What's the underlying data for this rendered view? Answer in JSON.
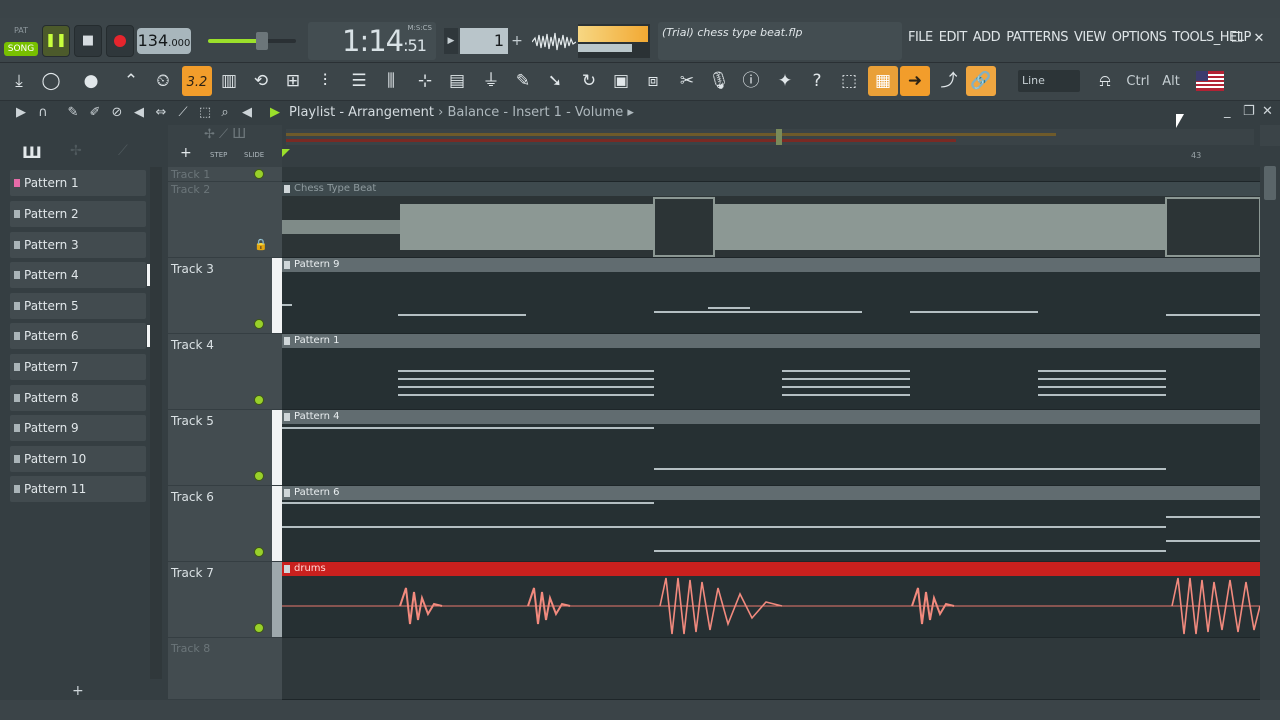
{
  "transport": {
    "pat_label": "PAT",
    "song_label": "SONG",
    "tempo_main": "134",
    "tempo_frac": ".000",
    "time_main": "1:14",
    "time_cs": ":51",
    "time_unit": "M:S:CS",
    "pattern_number": "1",
    "hint_text": "(Trial) chess type beat.flp"
  },
  "menu": {
    "items": [
      "FILE",
      "EDIT",
      "ADD",
      "PATTERNS",
      "VIEW",
      "OPTIONS",
      "TOOLS",
      "HELP"
    ]
  },
  "toolbar": {
    "tempo_tap_label": "3.2",
    "snap_mode": "Line",
    "ctrl_label": "Ctrl",
    "alt_label": "Alt"
  },
  "playlist": {
    "title": "Playlist - Arrangement",
    "breadcrumb": "Balance - Insert 1 - Volume",
    "step_label": "STEP",
    "slide_label": "SLIDE",
    "bar_marker": "43"
  },
  "patterns": [
    {
      "name": "Pattern 1",
      "active": true
    },
    {
      "name": "Pattern 2"
    },
    {
      "name": "Pattern 3"
    },
    {
      "name": "Pattern 4",
      "marked": true
    },
    {
      "name": "Pattern 5"
    },
    {
      "name": "Pattern 6",
      "marked": true
    },
    {
      "name": "Pattern 7"
    },
    {
      "name": "Pattern 8"
    },
    {
      "name": "Pattern 9"
    },
    {
      "name": "Pattern 10"
    },
    {
      "name": "Pattern 11"
    }
  ],
  "tracks": [
    {
      "name": "Track 1",
      "dim": true
    },
    {
      "name": "Track 2",
      "dim": true,
      "clip": "Chess Type Beat"
    },
    {
      "name": "Track 3",
      "clip": "Pattern 9"
    },
    {
      "name": "Track 4",
      "clip": "Pattern 1"
    },
    {
      "name": "Track 5",
      "clip": "Pattern 4"
    },
    {
      "name": "Track 6",
      "clip": "Pattern 6"
    },
    {
      "name": "Track 7",
      "clip": "drums"
    },
    {
      "name": "Track 8",
      "dim": true
    }
  ],
  "colors": {
    "accent_green": "#99d02a",
    "accent_orange": "#f29d2b",
    "record_red": "#e6252d",
    "drums_clip": "#c9201e"
  }
}
